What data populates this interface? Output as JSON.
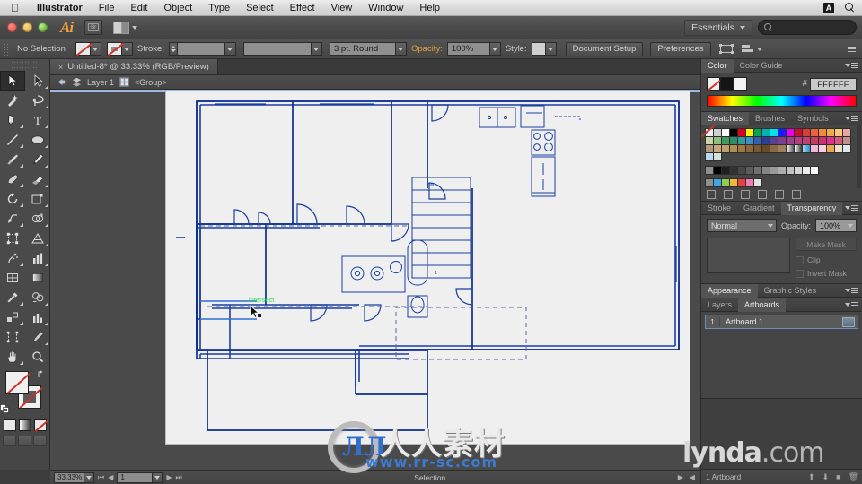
{
  "menubar": {
    "apple": "apple-logo",
    "items": [
      "Illustrator",
      "File",
      "Edit",
      "Object",
      "Type",
      "Select",
      "Effect",
      "View",
      "Window",
      "Help"
    ],
    "right_icons": [
      "adobe-icon",
      "spotlight-search-icon"
    ]
  },
  "titlebar": {
    "app_logo": "Ai",
    "bridge_label": "Br",
    "arrange_label": "arrange-documents",
    "workspace": "Essentials",
    "search_placeholder": ""
  },
  "controlbar": {
    "selection_state": "No Selection",
    "fill_label": "fill-none",
    "stroke_label": "stroke-none",
    "stroke_text": "Stroke:",
    "stroke_weight": "",
    "stroke_profile": "",
    "brush_definition": "3 pt. Round",
    "opacity_label": "Opacity:",
    "opacity_value": "100%",
    "style_label": "Style:",
    "document_setup": "Document Setup",
    "preferences": "Preferences"
  },
  "document": {
    "tab_title": "Untitled-8* @ 33.33% (RGB/Preview)",
    "close_glyph": "×",
    "breadcrumb_layer": "Layer 1",
    "breadcrumb_group": "<Group>"
  },
  "tools": {
    "column_left": [
      "selection-tool",
      "magic-wand-tool",
      "pen-tool",
      "line-segment-tool",
      "paintbrush-tool",
      "blob-brush-tool",
      "rotate-tool",
      "width-tool",
      "free-transform-tool",
      "symbol-sprayer-tool",
      "mesh-tool",
      "eyedropper-tool",
      "blend-tool",
      "artboard-tool",
      "hand-tool"
    ],
    "column_right": [
      "direct-selection-tool",
      "lasso-tool",
      "type-tool",
      "ellipse-tool",
      "pencil-tool",
      "eraser-tool",
      "scale-tool",
      "shape-builder-tool",
      "perspective-grid-tool",
      "column-graph-tool",
      "gradient-tool",
      "live-paint-bucket-tool",
      "column-graph-tool-2",
      "zoom-tool"
    ],
    "fill_state": "none",
    "stroke_state": "none",
    "color_modes": [
      "color",
      "gradient",
      "none"
    ],
    "screen_modes": [
      "normal-screen-mode",
      "full-screen-menu-bar",
      "full-screen"
    ]
  },
  "canvas": {
    "smart_guide_label": "intersect",
    "cursor": "selection-arrow-cursor",
    "artboard_bg": "#efefef",
    "line_color": "#1a3fa0"
  },
  "statusbar": {
    "zoom_level": "33.33%",
    "page_number": "1",
    "status_text": "Selection"
  },
  "panels": {
    "color": {
      "tabs": [
        "Color",
        "Color Guide"
      ],
      "active_tab": "Color",
      "hex_prefix": "#",
      "hex_value": "FFFFFF"
    },
    "swatches": {
      "tabs": [
        "Swatches",
        "Brushes",
        "Symbols"
      ],
      "active_tab": "Swatches"
    },
    "transparency": {
      "tabs": [
        "Stroke",
        "Gradient",
        "Transparency"
      ],
      "active_tab": "Transparency",
      "blend_mode": "Normal",
      "opacity_label": "Opacity:",
      "opacity_value": "100%",
      "make_mask": "Make Mask",
      "clip_label": "Clip",
      "invert_mask_label": "Invert Mask"
    },
    "appearance": {
      "tabs": [
        "Appearance",
        "Graphic Styles"
      ],
      "active_tab": "Appearance"
    },
    "layers": {
      "tabs": [
        "Layers",
        "Artboards"
      ],
      "active_tab": "Artboards",
      "row_number": "1",
      "row_name": "Artboard 1",
      "footer_count": "1 Artboard"
    }
  },
  "watermarks": {
    "center_cn": "人人素材",
    "center_url_prefix": "www.",
    "center_url_mid": "rr-sc",
    "center_url_suffix": ".com",
    "corner": "lynda",
    "corner_suffix": ".com"
  }
}
